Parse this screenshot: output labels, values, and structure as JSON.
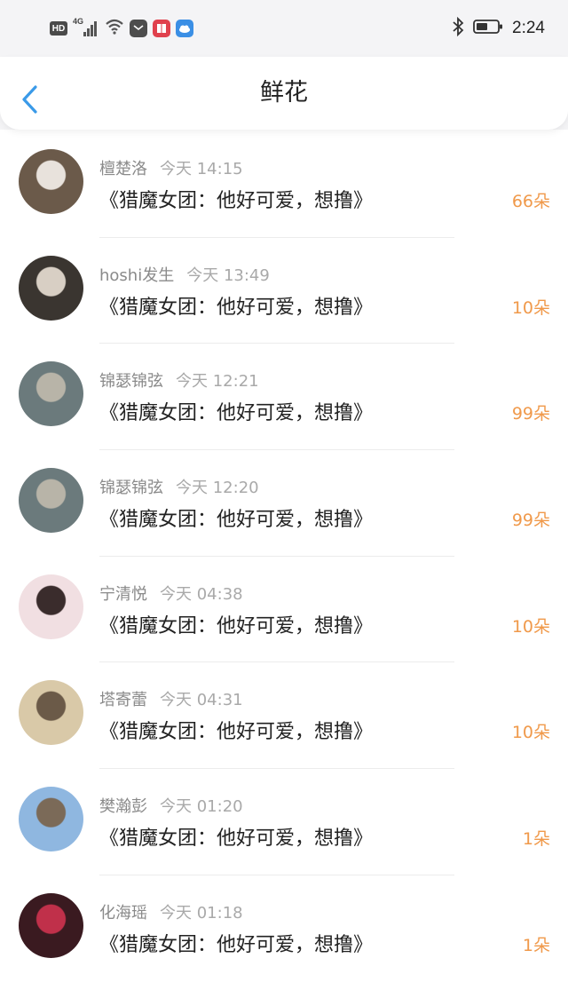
{
  "status_bar": {
    "hd": "HD",
    "network": "4G",
    "time": "2:24",
    "icons": [
      "signal-icon",
      "wifi-icon",
      "mail-icon",
      "book-app-icon",
      "cloud-app-icon",
      "bluetooth-icon",
      "battery-icon"
    ],
    "colors": {
      "book_app": "#e0414d",
      "cloud_app": "#3b8fe5"
    }
  },
  "header": {
    "title": "鲜花",
    "back_icon": "chevron-left-icon",
    "accent": "#3a9ae8"
  },
  "items": [
    {
      "name": "檀楚洛",
      "time": "今天 14:15",
      "message": "《猎魔女团：他好可爱，想撸》",
      "count": "66朵",
      "avatar_colors": [
        "#6b5a4a",
        "#e8e2dc"
      ]
    },
    {
      "name": "hoshi发生",
      "time": "今天 13:49",
      "message": "《猎魔女团：他好可爱，想撸》",
      "count": "10朵",
      "avatar_colors": [
        "#3a3530",
        "#d8cfc4"
      ]
    },
    {
      "name": "锦瑟锦弦",
      "time": "今天 12:21",
      "message": "《猎魔女团：他好可爱，想撸》",
      "count": "99朵",
      "avatar_colors": [
        "#6b7a7c",
        "#b8b4a8"
      ]
    },
    {
      "name": "锦瑟锦弦",
      "time": "今天 12:20",
      "message": "《猎魔女团：他好可爱，想撸》",
      "count": "99朵",
      "avatar_colors": [
        "#6b7a7c",
        "#b8b4a8"
      ]
    },
    {
      "name": "宁清悦",
      "time": "今天 04:38",
      "message": "《猎魔女团：他好可爱，想撸》",
      "count": "10朵",
      "avatar_colors": [
        "#f1dfe2",
        "#3a2c2c"
      ]
    },
    {
      "name": "塔寄蕾",
      "time": "今天 04:31",
      "message": "《猎魔女团：他好可爱，想撸》",
      "count": "10朵",
      "avatar_colors": [
        "#d9c9a8",
        "#6b5a48"
      ]
    },
    {
      "name": "樊瀚彭",
      "time": "今天 01:20",
      "message": "《猎魔女团：他好可爱，想撸》",
      "count": "1朵",
      "avatar_colors": [
        "#8fb7e0",
        "#7b6a58"
      ]
    },
    {
      "name": "化海瑶",
      "time": "今天 01:18",
      "message": "《猎魔女团：他好可爱，想撸》",
      "count": "1朵",
      "avatar_colors": [
        "#3a1a20",
        "#c0304a"
      ]
    }
  ]
}
